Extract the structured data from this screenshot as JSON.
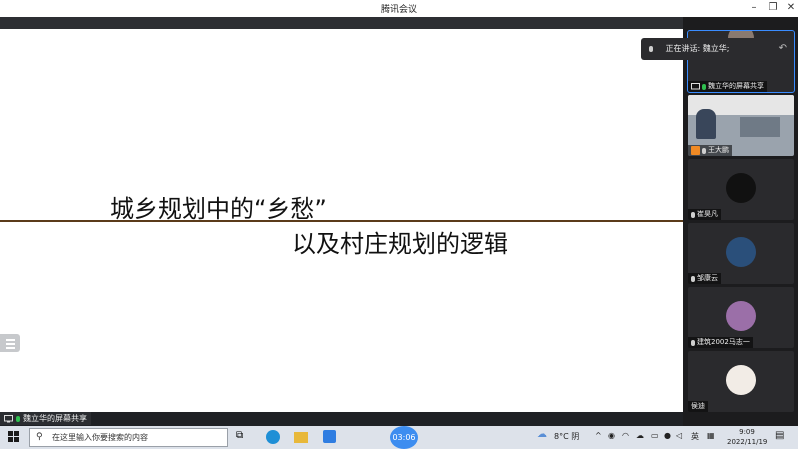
{
  "app": {
    "title": "腾讯会议"
  },
  "slide": {
    "line1": "城乡规划中的“乡愁”",
    "line2": "以及村庄规划的逻辑"
  },
  "share_label": "魏立华的屏幕共享",
  "speaking": {
    "label": "正在讲话: 魏立华;"
  },
  "participants": [
    {
      "name": "魏立华的屏幕共享"
    },
    {
      "name": "王大鹏"
    },
    {
      "name": "崔昊凡"
    },
    {
      "name": "邹康云"
    },
    {
      "name": "建筑2002马志一"
    },
    {
      "name": "侯迪"
    }
  ],
  "taskbar": {
    "search_placeholder": "在这里输入你要搜索的内容",
    "timer": "03:06",
    "weather": "8°C 阴",
    "ime": "英",
    "time": "9:09",
    "date": "2022/11/19"
  },
  "colors": {
    "accent": "#3d8df0",
    "slide_rule": "#5b3b1a"
  }
}
